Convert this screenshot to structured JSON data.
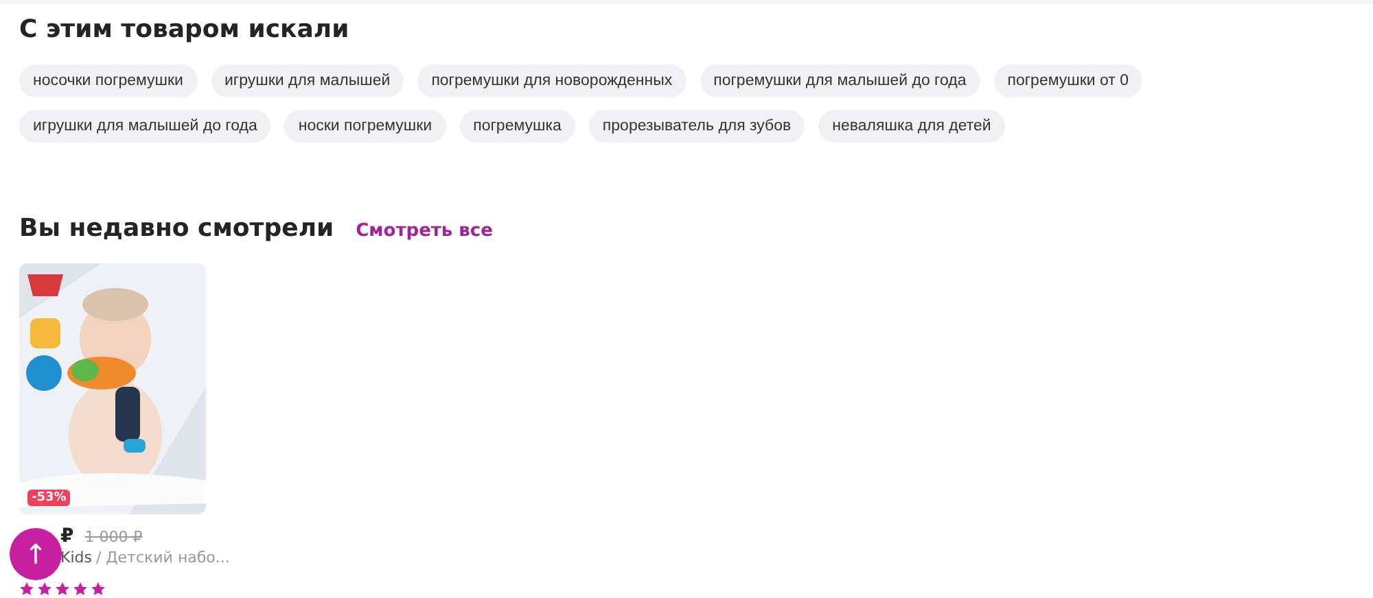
{
  "searched": {
    "title": "С этим товаром искали",
    "chips": [
      "носочки погремушки",
      "игрушки для малышей",
      "погремушки для новорожденных",
      "погремушки для малышей до года",
      "погремушки от 0",
      "игрушки для малышей до года",
      "носки погремушки",
      "погремушка",
      "прорезыватель для зубов",
      "неваляшка для детей"
    ]
  },
  "recent": {
    "title": "Вы недавно смотрели",
    "link": "Смотреть все",
    "products": [
      {
        "discount": "-53%",
        "price": "₽",
        "old_price": "1 000 ₽",
        "brand": "Kids",
        "name": "/ Детский набо...",
        "stars": 5
      }
    ]
  },
  "scroll_top": {
    "icon": "↑"
  }
}
